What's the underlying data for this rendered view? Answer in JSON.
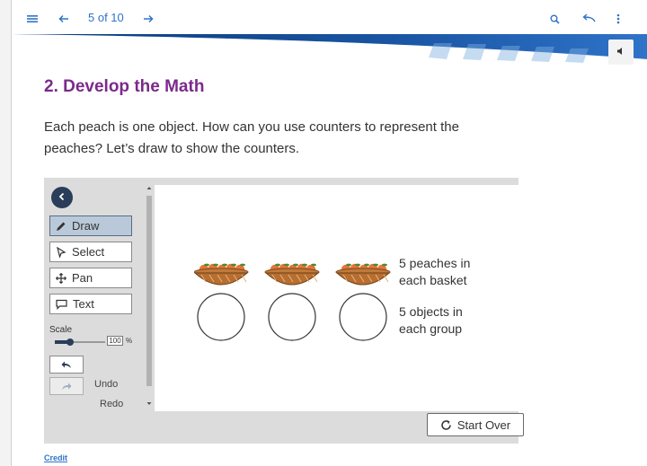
{
  "topbar": {
    "menu_icon": "menu-icon",
    "prev_icon": "arrow-left-icon",
    "page_counter": "5 of 10",
    "next_icon": "arrow-right-icon",
    "search_icon": "search-icon",
    "return_icon": "return-arrow-icon",
    "more_icon": "kebab-menu-icon",
    "accent_color": "#2f73c8"
  },
  "banner": {
    "colors": [
      "#0a3a7a",
      "#2f73c8",
      "#7fb0e0"
    ]
  },
  "speaker_icon": "speaker-icon",
  "lesson": {
    "section_title": "2. Develop the Math",
    "section_title_color": "#7b2a8a",
    "instructions": "Each peach is one object. How can you use counters to represent the peaches? Let’s draw to show the counters."
  },
  "tools": {
    "back_icon": "chevron-left-icon",
    "items": [
      {
        "label": "Draw",
        "icon": "pencil-icon",
        "active": true
      },
      {
        "label": "Select",
        "icon": "cursor-icon",
        "active": false
      },
      {
        "label": "Pan",
        "icon": "move-icon",
        "active": false
      },
      {
        "label": "Text",
        "icon": "speech-bubble-icon",
        "active": false
      }
    ],
    "scale_label": "Scale",
    "scale_value": "100",
    "scale_unit": "%",
    "slider_level": 0.3,
    "undo_label": "Undo",
    "redo_label": "Redo"
  },
  "canvas": {
    "basket_count": 3,
    "basket_label": "5 peaches in each basket",
    "basket_label_lines": [
      "5 peaches in",
      "each basket"
    ],
    "group_count": 3,
    "group_label_lines": [
      "5 objects in",
      "each group"
    ]
  },
  "start_over_label": "Start Over",
  "credit_label": "Credit"
}
